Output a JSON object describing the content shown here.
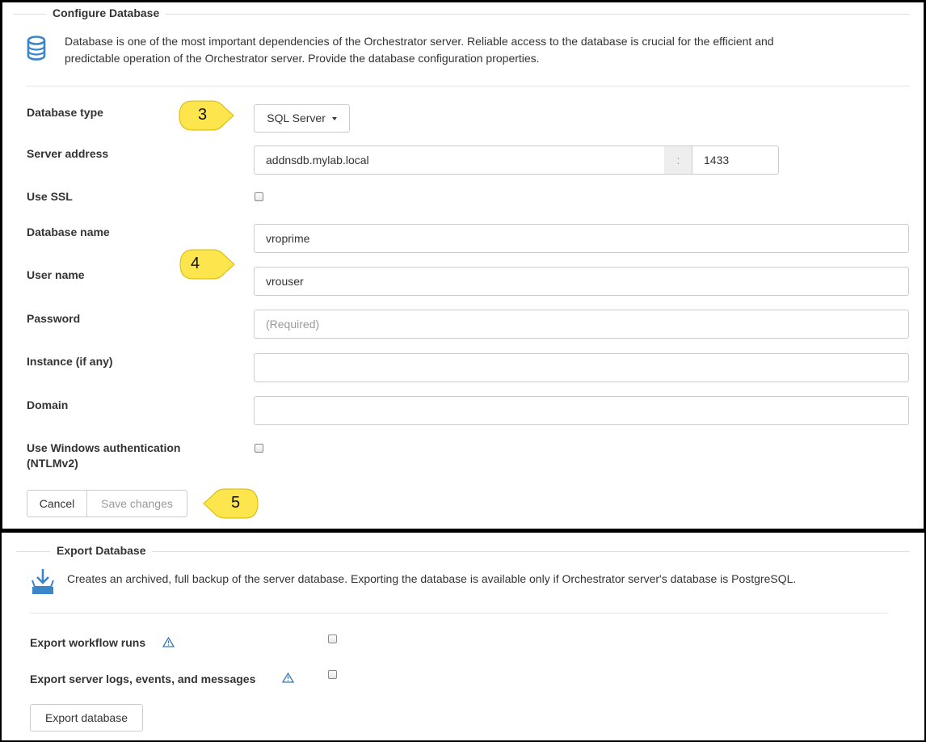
{
  "configure": {
    "legend": "Configure Database",
    "icon": "database-icon",
    "description_line1": "Database is one of the most important dependencies of the Orchestrator server. Reliable access to the database is crucial for the efficient and",
    "description_line2": "predictable operation of the Orchestrator server. Provide the database configuration properties.",
    "labels": {
      "db_type": "Database type",
      "server_address": "Server address",
      "use_ssl": "Use SSL",
      "db_name": "Database name",
      "user_name": "User name",
      "password": "Password",
      "instance": "Instance (if any)",
      "domain": "Domain",
      "windows_auth_line1": "Use Windows authentication",
      "windows_auth_line2": "(NTLMv2)"
    },
    "db_type_value": "SQL Server",
    "server_host": "addnsdb.mylab.local",
    "port_separator": ":",
    "server_port": "1433",
    "use_ssl_checked": false,
    "db_name_value": "vroprime",
    "user_name_value": "vrouser",
    "password_placeholder": "(Required)",
    "instance_value": "",
    "domain_value": "",
    "windows_auth_checked": false,
    "cancel_label": "Cancel",
    "save_label": "Save changes"
  },
  "export": {
    "legend": "Export Database",
    "icon": "download-tray-icon",
    "description": "Creates an archived, full backup of the server database. Exporting the database is available only if Orchestrator server's database is PostgreSQL.",
    "workflow_runs_label": "Export workflow runs",
    "logs_label": "Export server logs, events, and messages",
    "workflow_runs_checked": false,
    "logs_checked": false,
    "export_button": "Export database"
  },
  "callouts": [
    "3",
    "4",
    "5"
  ],
  "colors": {
    "callout_fill": "#fce54d",
    "callout_stroke": "#d9b800",
    "icon_blue": "#3a86c8",
    "warning_blue": "#3b77b8"
  }
}
